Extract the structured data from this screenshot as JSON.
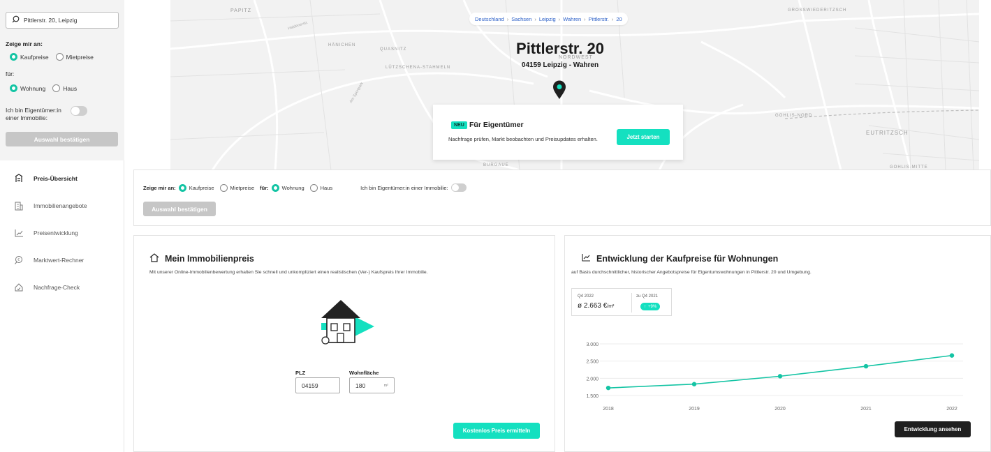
{
  "search": {
    "value": "Pittlerstr. 20, Leipzig",
    "icon": "search-icon"
  },
  "sidebar": {
    "show_label": "Zeige mir an:",
    "price_options": [
      {
        "label": "Kaufpreise",
        "selected": true
      },
      {
        "label": "Mietpreise",
        "selected": false
      }
    ],
    "for_label": "für:",
    "type_options": [
      {
        "label": "Wohnung",
        "selected": true
      },
      {
        "label": "Haus",
        "selected": false
      }
    ],
    "owner_label": "Ich bin Eigentümer:in einer Immobilie:",
    "owner_toggle": false,
    "confirm_label": "Auswahl bestätigen",
    "nav": [
      {
        "label": "Preis-Übersicht",
        "icon": "price-overview-icon",
        "active": true
      },
      {
        "label": "Immobilienangebote",
        "icon": "building-icon",
        "active": false
      },
      {
        "label": "Preisentwicklung",
        "icon": "trend-chart-icon",
        "active": false
      },
      {
        "label": "Marktwert-Rechner",
        "icon": "calculator-search-icon",
        "active": false
      },
      {
        "label": "Nachfrage-Check",
        "icon": "house-check-icon",
        "active": false
      }
    ]
  },
  "map": {
    "breadcrumb": [
      "Deutschland",
      "Sachsen",
      "Leipzig",
      "Wahren",
      "Pittlerstr.",
      "20"
    ],
    "address_title": "Pittlerstr. 20",
    "address_sub": "04159 Leipzig - Wahren",
    "place_labels": [
      "PAPITZ",
      "HÄNICHEN",
      "QUASNITZ",
      "LÜTZSCHENA-STAHMELN",
      "NORDWEST",
      "GROSSWIEDERITZSCH",
      "GOHLIS-NORD",
      "EUTRITZSCH",
      "BURGAUE",
      "GOHLIS-MITTE"
    ],
    "street_labels": [
      "Haldenerstr.",
      "Am Sportpark"
    ],
    "owner_card": {
      "badge": "NEU",
      "title": "Für Eigentümer",
      "description": "Nachfrage prüfen, Markt beobachten und Preisupdates erhalten.",
      "button": "Jetzt starten"
    }
  },
  "filter_bar": {
    "show_label": "Zeige mir an:",
    "price_options": [
      {
        "label": "Kaufpreise",
        "selected": true
      },
      {
        "label": "Mietpreise",
        "selected": false
      }
    ],
    "for_label": "für:",
    "type_options": [
      {
        "label": "Wohnung",
        "selected": true
      },
      {
        "label": "Haus",
        "selected": false
      }
    ],
    "owner_label": "Ich bin Eigentümer:in einer Immobilie:",
    "confirm_label": "Auswahl bestätigen"
  },
  "valuation": {
    "title": "Mein Immobilienpreis",
    "description": "Mit unserer Online-Immobilienbewertung erhalten Sie schnell und unkompliziert einen realistischen (Ver-) Kaufspreis Ihrer Immobilie.",
    "plz_label": "PLZ",
    "plz_value": "04159",
    "area_label": "Wohnfläche",
    "area_value": "180",
    "area_unit": "m²",
    "button": "Kostenlos Preis ermitteln"
  },
  "development": {
    "title": "Entwicklung der Kaufpreise für Wohnungen",
    "description": "auf Basis durchschnittlicher, historischer Angebotspreise für Eigentumswohnungen in Pittlerstr. 20 und Umgebung.",
    "stat_quarter": "Q4 2022",
    "stat_value": "ø 2.663 €",
    "stat_unit": "/m²",
    "compare_label": "zu Q4 2021",
    "change": "+9%",
    "button": "Entwicklung ansehen"
  },
  "chart_data": {
    "type": "line",
    "x": [
      "2018",
      "2019",
      "2020",
      "2021",
      "2022"
    ],
    "yticks": [
      "3.000",
      "2.500",
      "2.000",
      "1.500"
    ],
    "ylim": [
      1500,
      3000
    ],
    "series": [
      {
        "values": [
          1720,
          1830,
          2060,
          2350,
          2663
        ]
      }
    ],
    "color": "#14c4a4",
    "grid": true
  },
  "colors": {
    "accent": "#14e0c0",
    "accent_dark": "#14c4a4",
    "muted_button": "#c6c6c6",
    "dark_button": "#1f1f1f"
  }
}
